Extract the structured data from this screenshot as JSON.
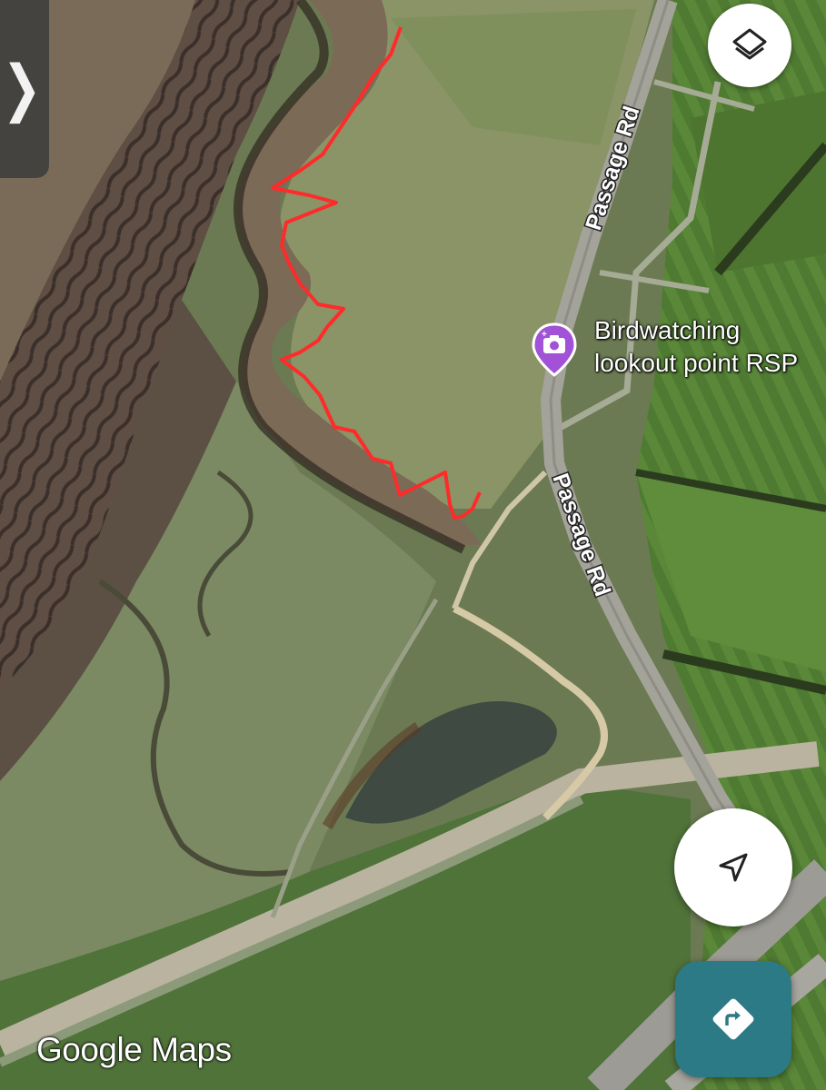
{
  "map": {
    "roads": [
      {
        "label": "Passage Rd"
      },
      {
        "label": "Passage Rd"
      }
    ],
    "poi": {
      "label": "Birdwatching\nlookout point RSP",
      "icon": "camera-icon",
      "color": "#a152d6"
    },
    "route_color": "#ff2a2a"
  },
  "controls": {
    "side_panel_icon": "chevron-right-icon",
    "layers_icon": "layers-icon",
    "navigation_icon": "navigation-arrow-icon",
    "directions_icon": "directions-icon",
    "directions_color": "#2c7a85"
  },
  "branding": {
    "text": "Google Maps"
  }
}
